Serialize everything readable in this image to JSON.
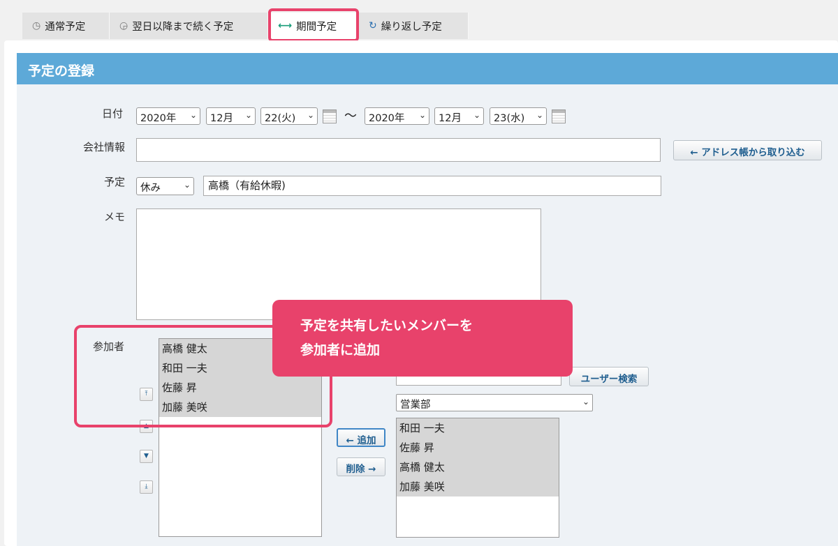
{
  "tabs": [
    {
      "label": "通常予定",
      "icon": "clock-icon"
    },
    {
      "label": "翌日以降まで続く予定",
      "icon": "clock-arrow-icon"
    },
    {
      "label": "期間予定",
      "icon": "double-arrow-icon"
    },
    {
      "label": "繰り返し予定",
      "icon": "repeat-icon"
    }
  ],
  "header": {
    "title": "予定の登録"
  },
  "date": {
    "label": "日付",
    "start_year": "2020年",
    "start_month": "12月",
    "start_day": "22(火)",
    "separator": "〜",
    "end_year": "2020年",
    "end_month": "12月",
    "end_day": "23(水)"
  },
  "company": {
    "label": "会社情報",
    "value": "",
    "address_button": "← アドレス帳から取り込む"
  },
  "schedule": {
    "label": "予定",
    "type": "休み",
    "title": "高橋（有給休暇)"
  },
  "memo": {
    "label": "メモ",
    "value": ""
  },
  "participants": {
    "label": "参加者",
    "selected": [
      "高橋 健太",
      "和田 一夫",
      "佐藤 昇",
      "加藤 美咲"
    ],
    "search_value": "",
    "search_button": "ユーザー検索",
    "group": "営業部",
    "candidates": [
      "和田 一夫",
      "佐藤 昇",
      "高橋 健太",
      "加藤 美咲"
    ],
    "add_button": "← 追加",
    "remove_button": "削除 →"
  },
  "callout": {
    "line1": "予定を共有したいメンバーを",
    "line2": "参加者に追加"
  },
  "colors": {
    "header": "#5da9d8",
    "highlight": "#e8426b",
    "form_bg": "#eef2f6"
  }
}
